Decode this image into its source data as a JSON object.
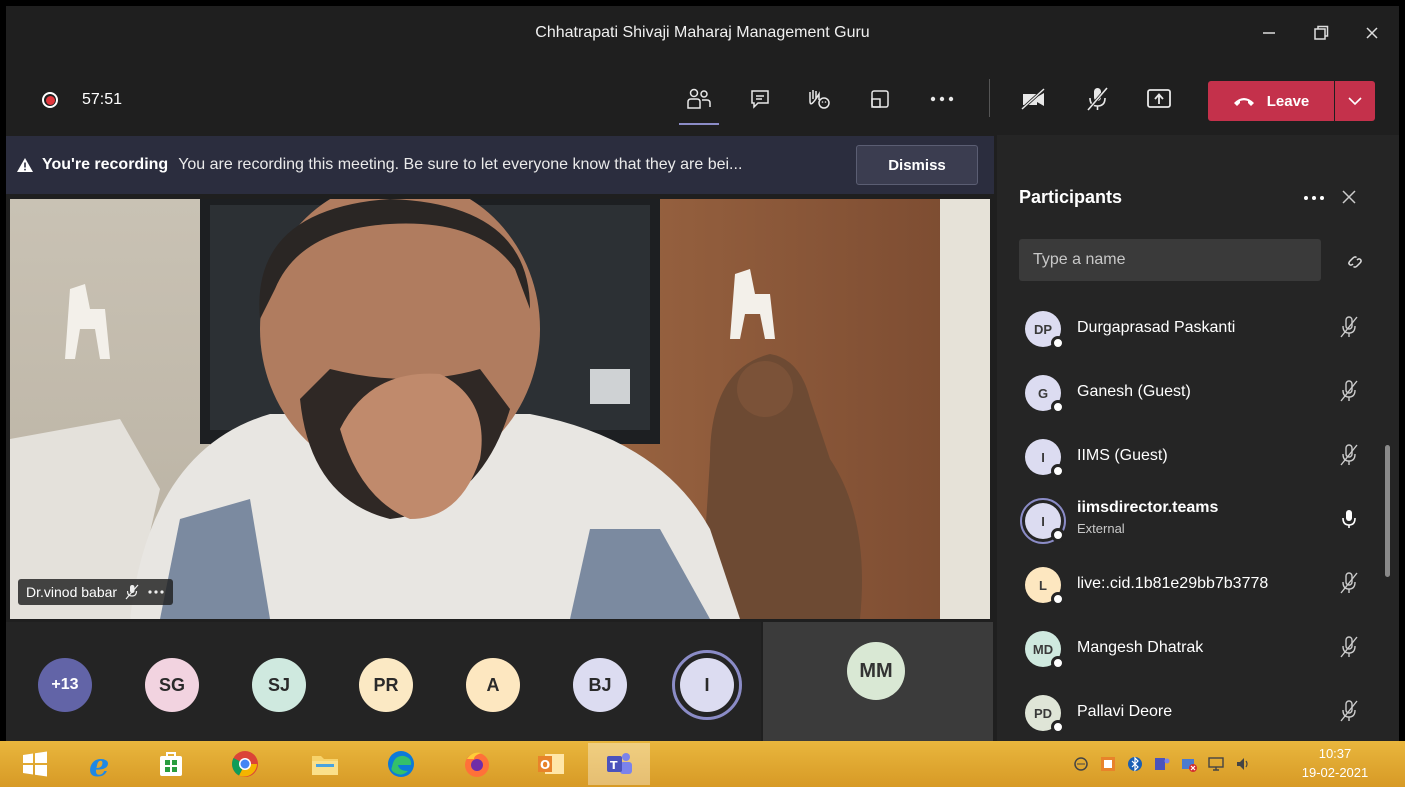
{
  "window": {
    "title": "Chhatrapati Shivaji Maharaj Management Guru"
  },
  "toolbar": {
    "timer": "57:51",
    "leave_label": "Leave"
  },
  "banner": {
    "title": "You're recording",
    "message": "You are recording this meeting. Be sure to let everyone know that they are bei...",
    "dismiss_label": "Dismiss"
  },
  "video": {
    "speaker_name": "Dr.vinod babar"
  },
  "strip": {
    "overflow_count": "+13",
    "avatars": [
      {
        "initials": "SG",
        "color": "#f2d3e0"
      },
      {
        "initials": "SJ",
        "color": "#cfe9df"
      },
      {
        "initials": "PR",
        "color": "#fbe9c4"
      },
      {
        "initials": "A",
        "color": "#fde7c0"
      },
      {
        "initials": "BJ",
        "color": "#dcdcf1"
      },
      {
        "initials": "I",
        "color": "#dcdcf1"
      }
    ],
    "tile_initials": "MM"
  },
  "participants": {
    "title": "Participants",
    "search_placeholder": "Type a name",
    "items": [
      {
        "initials": "DP",
        "name": "Durgaprasad Paskanti",
        "color": "#dcdcf1",
        "muted": true
      },
      {
        "initials": "G",
        "name": "Ganesh (Guest)",
        "color": "#dcdcf1",
        "muted": true
      },
      {
        "initials": "I",
        "name": "IIMS (Guest)",
        "color": "#dcdcf1",
        "muted": true
      },
      {
        "initials": "I",
        "name": "iimsdirector.teams",
        "sub": "External",
        "color": "#dcdcf1",
        "muted": false
      },
      {
        "initials": "L",
        "name": "live:.cid.1b81e29bb7b3778",
        "color": "#fde7c0",
        "muted": true
      },
      {
        "initials": "MD",
        "name": "Mangesh Dhatrak",
        "color": "#cfe9df",
        "muted": true
      },
      {
        "initials": "PD",
        "name": "Pallavi Deore",
        "color": "#dfe5d7",
        "muted": true
      }
    ]
  },
  "taskbar": {
    "time": "10:37",
    "date": "19-02-2021"
  }
}
